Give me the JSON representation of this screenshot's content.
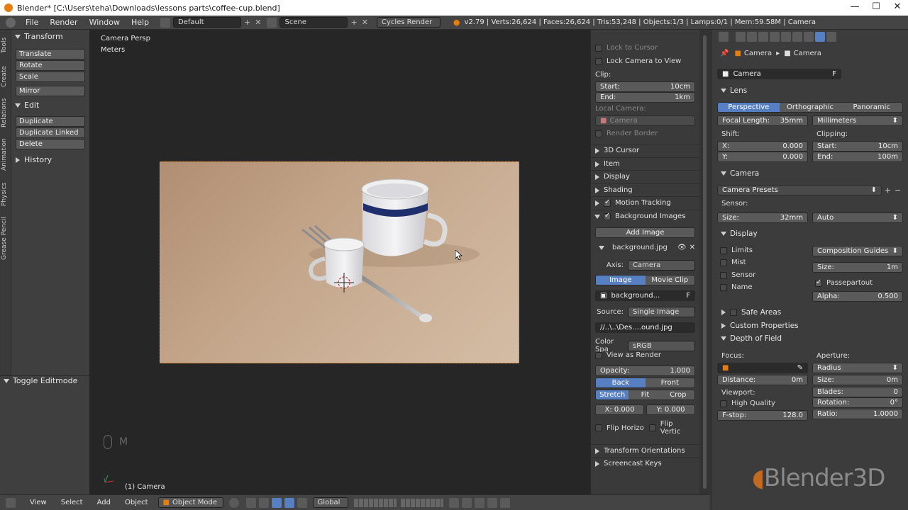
{
  "window": {
    "title": "Blender* [C:\\Users\\teha\\Downloads\\lessons parts\\coffee-cup.blend]",
    "min": "—",
    "max": "☐",
    "close": "✕"
  },
  "topbar": {
    "menus": [
      "File",
      "Render",
      "Window",
      "Help"
    ],
    "layout": "Default",
    "scene": "Scene",
    "engine": "Cycles Render",
    "stats": "v2.79 | Verts:26,624 | Faces:26,624 | Tris:53,248 | Objects:1/3 | Lamps:0/1 | Mem:59.58M | Camera"
  },
  "vtabs": [
    "Tools",
    "Create",
    "Relations",
    "Animation",
    "Physics",
    "Grease Pencil"
  ],
  "toolshelf": {
    "transform": "Transform",
    "translate": "Translate",
    "rotate": "Rotate",
    "scale": "Scale",
    "mirror": "Mirror",
    "edit": "Edit",
    "duplicate": "Duplicate",
    "duplicate_linked": "Duplicate Linked",
    "delete": "Delete",
    "history": "History",
    "toggle_editmode": "Toggle Editmode"
  },
  "viewport": {
    "persp": "Camera Persp",
    "units": "Meters",
    "object": "(1) Camera",
    "mouse_key": "M"
  },
  "viewhdr": {
    "view": "View",
    "select": "Select",
    "add": "Add",
    "object": "Object",
    "mode": "Object Mode",
    "orientation": "Global"
  },
  "npanel": {
    "lock_cursor": "Lock to Cursor",
    "lock_camera": "Lock Camera to View",
    "clip": "Clip:",
    "start_l": "Start:",
    "start_v": "10cm",
    "end_l": "End:",
    "end_v": "1km",
    "local_camera": "Local Camera:",
    "camera": "Camera",
    "render_border": "Render Border",
    "sections": [
      "3D Cursor",
      "Item",
      "Display",
      "Shading",
      "Motion Tracking",
      "Background Images"
    ],
    "add_image": "Add Image",
    "bg_name": "background.jpg",
    "axis_l": "Axis:",
    "axis_v": "Camera",
    "image": "Image",
    "movie_clip": "Movie Clip",
    "bg_file": "background...",
    "f": "F",
    "source_l": "Source:",
    "source_v": "Single Image",
    "path": "//..\\..\\Des....ound.jpg",
    "colorspace_l": "Color Spa",
    "colorspace_v": "sRGB",
    "view_as_render": "View as Render",
    "opacity_l": "Opacity:",
    "opacity_v": "1.000",
    "back": "Back",
    "front": "Front",
    "stretch": "Stretch",
    "fit": "Fit",
    "crop": "Crop",
    "x": "X: 0.000",
    "y": "Y: 0.000",
    "flip_h": "Flip Horizo",
    "flip_v": "Flip Vertic",
    "transform_orient": "Transform Orientations",
    "screencast": "Screencast Keys"
  },
  "props": {
    "crumb1": "Camera",
    "crumb2": "Camera",
    "datablock": "Camera",
    "f": "F",
    "lens": "Lens",
    "perspective": "Perspective",
    "orthographic": "Orthographic",
    "panoramic": "Panoramic",
    "focal_l": "Focal Length:",
    "focal_v": "35mm",
    "focal_unit": "Millimeters",
    "shift": "Shift:",
    "shift_x_l": "X:",
    "shift_x_v": "0.000",
    "shift_y_l": "Y:",
    "shift_y_v": "0.000",
    "clipping": "Clipping:",
    "clip_start_l": "Start:",
    "clip_start_v": "10cm",
    "clip_end_l": "End:",
    "clip_end_v": "100m",
    "camera": "Camera",
    "presets": "Camera Presets",
    "sensor": "Sensor:",
    "size_l": "Size:",
    "size_v": "32mm",
    "sensor_fit": "Auto",
    "display": "Display",
    "limits": "Limits",
    "mist": "Mist",
    "sensor_chk": "Sensor",
    "name": "Name",
    "comp_guides": "Composition Guides",
    "disp_size_l": "Size:",
    "disp_size_v": "1m",
    "passepartout": "Passepartout",
    "alpha_l": "Alpha:",
    "alpha_v": "0.500",
    "safe_areas": "Safe Areas",
    "custom_props": "Custom Properties",
    "dof": "Depth of Field",
    "focus": "Focus:",
    "aperture": "Aperture:",
    "radius": "Radius",
    "distance_l": "Distance:",
    "distance_v": "0m",
    "ap_size_l": "Size:",
    "ap_size_v": "0m",
    "viewport": "Viewport:",
    "blades_l": "Blades:",
    "blades_v": "0",
    "high_quality": "High Quality",
    "rotation_l": "Rotation:",
    "rotation_v": "0°",
    "fstop_l": "F-stop:",
    "fstop_v": "128.0",
    "ratio_l": "Ratio:",
    "ratio_v": "1.0000"
  },
  "watermark": "Blender3D",
  "colors": {
    "accent": "#5680c2",
    "orange": "#e87d0d"
  }
}
